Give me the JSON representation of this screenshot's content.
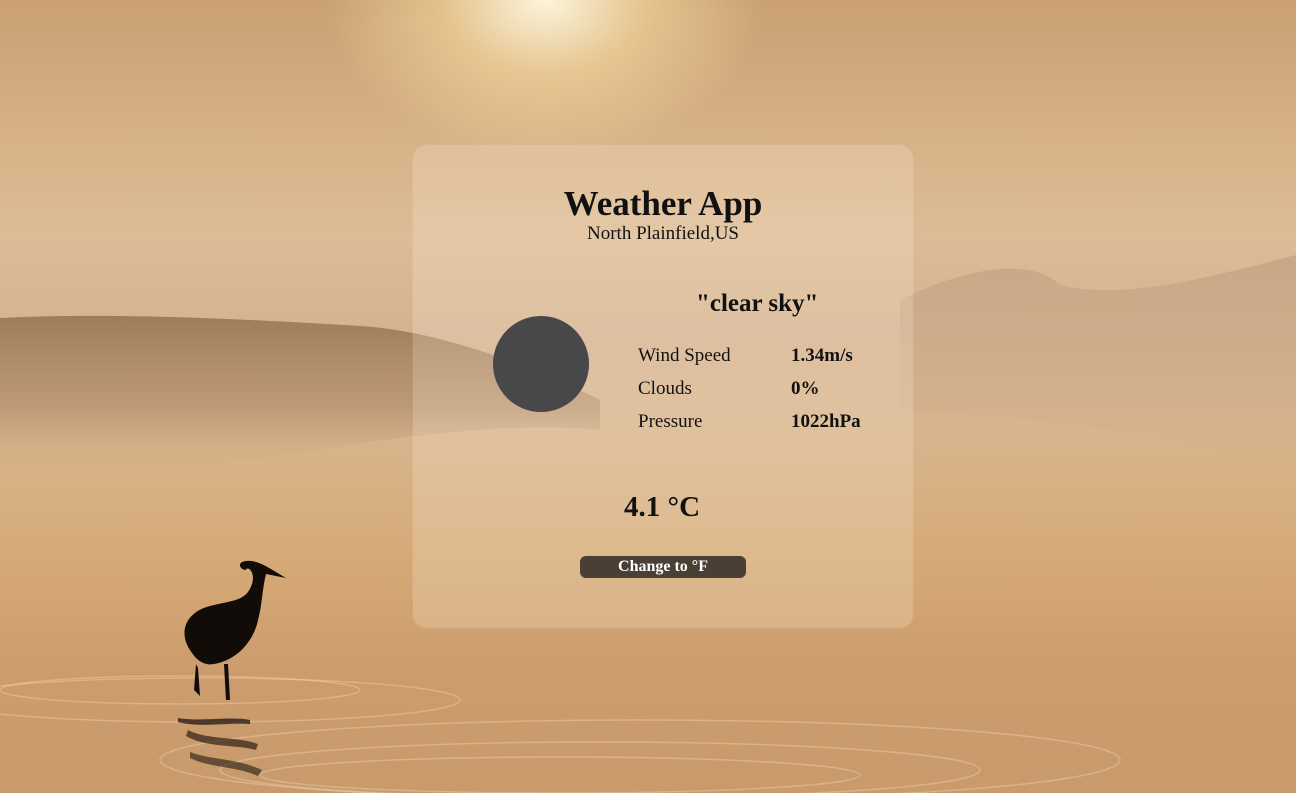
{
  "app": {
    "title": "Weather App",
    "location": "North Plainfield,US"
  },
  "weather": {
    "icon": "weather-condition-icon",
    "description": "\"clear sky\"",
    "stats": [
      {
        "label": "Wind Speed",
        "value": "1.34m/s"
      },
      {
        "label": "Clouds",
        "value": "0%"
      },
      {
        "label": "Pressure",
        "value": "1022hPa"
      }
    ],
    "temperature": "4.1 °C"
  },
  "controls": {
    "unit_toggle_label": "Change to °F"
  },
  "colors": {
    "icon_placeholder": "#48474a",
    "button_background": "#4a3f35",
    "button_text": "#ffffff"
  }
}
